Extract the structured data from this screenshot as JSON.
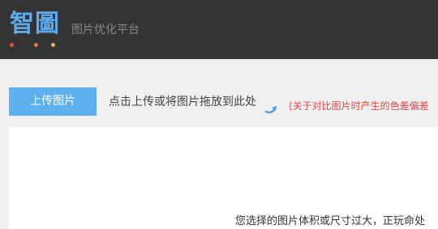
{
  "header": {
    "logo_text": "智圖",
    "logo_dot_colors": [
      "#e2533e",
      "#e9764a",
      "#e8b54c"
    ],
    "subtitle": "图片优化平台"
  },
  "upload": {
    "button_label": "上传图片",
    "hint": "点击上传或将图片拖放到此处",
    "note": "(关于对比图片时产生的色差偏差"
  },
  "panel": {
    "error_message": "您选择的图片体积或尺寸过大，正玩命处"
  },
  "colors": {
    "header_bg": "#343434",
    "logo": "#5da9e9",
    "button_bg": "#5fb0ee",
    "note": "#e04848"
  }
}
